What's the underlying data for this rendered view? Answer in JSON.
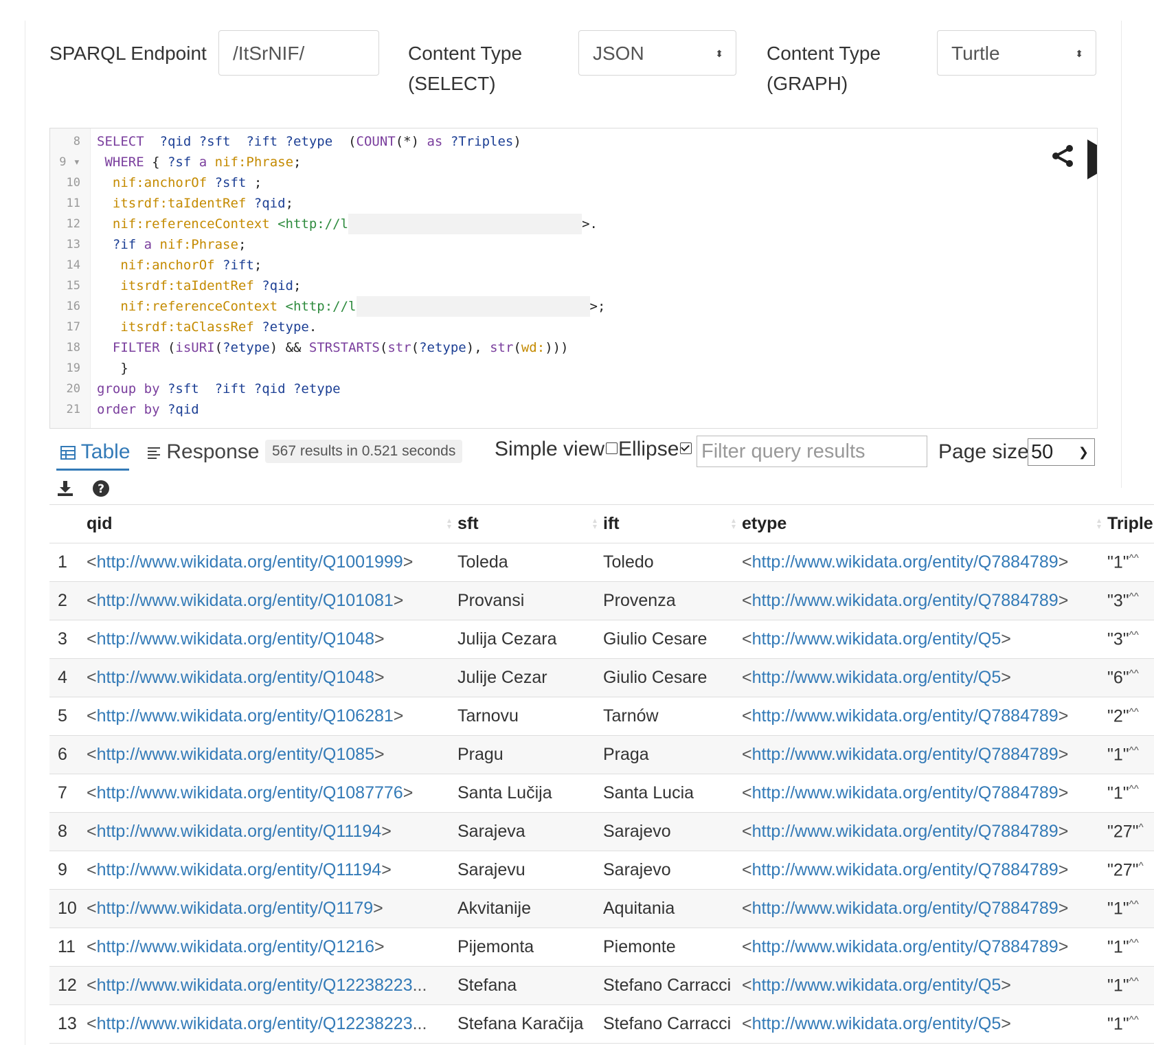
{
  "controls": {
    "endpoint_label": "SPARQL Endpoint",
    "endpoint_value": "/ItSrNIF/",
    "content_select_label_1": "Content Type",
    "content_select_label_2": "(SELECT)",
    "content_select_value": "JSON",
    "content_graph_label_1": "Content Type",
    "content_graph_label_2": "(GRAPH)",
    "content_graph_value": "Turtle"
  },
  "editor": {
    "lines": [
      {
        "n": "8",
        "parts": [
          [
            "kw",
            "SELECT  "
          ],
          [
            "var",
            "?qid ?sft  ?ift ?etype  "
          ],
          [
            "plain",
            "("
          ],
          [
            "kw",
            "COUNT"
          ],
          [
            "plain",
            "(*) "
          ],
          [
            "kw",
            "as "
          ],
          [
            "var",
            "?Triples"
          ],
          [
            "plain",
            ")"
          ]
        ]
      },
      {
        "n": "9 ▾",
        "parts": [
          [
            "plain",
            " "
          ],
          [
            "kw",
            "WHERE "
          ],
          [
            "plain",
            "{ "
          ],
          [
            "var",
            "?sf "
          ],
          [
            "kw",
            "a "
          ],
          [
            "pref",
            "nif:Phrase"
          ],
          [
            "plain",
            ";"
          ]
        ]
      },
      {
        "n": "10",
        "parts": [
          [
            "plain",
            "  "
          ],
          [
            "pref",
            "nif:anchorOf "
          ],
          [
            "var",
            "?sft "
          ],
          [
            "plain",
            ";"
          ]
        ]
      },
      {
        "n": "11",
        "parts": [
          [
            "plain",
            "  "
          ],
          [
            "pref",
            "itsrdf:taIdentRef "
          ],
          [
            "var",
            "?qid"
          ],
          [
            "plain",
            ";"
          ]
        ]
      },
      {
        "n": "12",
        "parts": [
          [
            "plain",
            "  "
          ],
          [
            "pref",
            "nif:referenceContext "
          ],
          [
            "iri",
            "<http://l"
          ],
          [
            "redact",
            ""
          ],
          [
            "plain",
            ">."
          ]
        ]
      },
      {
        "n": "13",
        "parts": [
          [
            "plain",
            "  "
          ],
          [
            "var",
            "?if "
          ],
          [
            "kw",
            "a "
          ],
          [
            "pref",
            "nif:Phrase"
          ],
          [
            "plain",
            ";"
          ]
        ]
      },
      {
        "n": "14",
        "parts": [
          [
            "plain",
            "   "
          ],
          [
            "pref",
            "nif:anchorOf "
          ],
          [
            "var",
            "?ift"
          ],
          [
            "plain",
            ";"
          ]
        ]
      },
      {
        "n": "15",
        "parts": [
          [
            "plain",
            "   "
          ],
          [
            "pref",
            "itsrdf:taIdentRef "
          ],
          [
            "var",
            "?qid"
          ],
          [
            "plain",
            ";"
          ]
        ]
      },
      {
        "n": "16",
        "parts": [
          [
            "plain",
            "   "
          ],
          [
            "pref",
            "nif:referenceContext "
          ],
          [
            "iri",
            "<http://l"
          ],
          [
            "redact",
            ""
          ],
          [
            "plain",
            ">;"
          ]
        ]
      },
      {
        "n": "17",
        "parts": [
          [
            "plain",
            "   "
          ],
          [
            "pref",
            "itsrdf:taClassRef "
          ],
          [
            "var",
            "?etype"
          ],
          [
            "plain",
            "."
          ]
        ]
      },
      {
        "n": "18",
        "parts": [
          [
            "plain",
            "  "
          ],
          [
            "kw",
            "FILTER "
          ],
          [
            "plain",
            "("
          ],
          [
            "kw",
            "isURI"
          ],
          [
            "plain",
            "("
          ],
          [
            "var",
            "?etype"
          ],
          [
            "plain",
            ") && "
          ],
          [
            "kw",
            "STRSTARTS"
          ],
          [
            "plain",
            "("
          ],
          [
            "kw",
            "str"
          ],
          [
            "plain",
            "("
          ],
          [
            "var",
            "?etype"
          ],
          [
            "plain",
            "), "
          ],
          [
            "kw",
            "str"
          ],
          [
            "plain",
            "("
          ],
          [
            "pref",
            "wd:"
          ],
          [
            "plain",
            ")))"
          ]
        ]
      },
      {
        "n": "19",
        "parts": [
          [
            "plain",
            "   }"
          ]
        ]
      },
      {
        "n": "20",
        "parts": [
          [
            "kw",
            "group by "
          ],
          [
            "var",
            "?sft  ?ift ?qid ?etype"
          ]
        ]
      },
      {
        "n": "21",
        "parts": [
          [
            "kw",
            "order by "
          ],
          [
            "var",
            "?qid"
          ]
        ]
      }
    ]
  },
  "results_bar": {
    "tab_table": "Table",
    "tab_response": "Response",
    "results_info": "567 results in 0.521 seconds",
    "simple_view_label": "Simple view",
    "ellipse_label": "Ellipse",
    "filter_placeholder": "Filter query results",
    "page_size_label": "Page size:",
    "page_size_value": "50"
  },
  "table": {
    "columns": [
      "qid",
      "sft",
      "ift",
      "etype",
      "Triple"
    ],
    "rows": [
      {
        "n": "1",
        "qid": "http://www.wikidata.org/entity/Q1001999",
        "qid_end": ">",
        "sft": "Toleda",
        "ift": "Toledo",
        "etype": "http://www.wikidata.org/entity/Q7884789",
        "triples": "\"1\"",
        "sup": "^^"
      },
      {
        "n": "2",
        "qid": "http://www.wikidata.org/entity/Q101081",
        "qid_end": ">",
        "sft": "Provansi",
        "ift": "Provenza",
        "etype": "http://www.wikidata.org/entity/Q7884789",
        "triples": "\"3\"",
        "sup": "^^"
      },
      {
        "n": "3",
        "qid": "http://www.wikidata.org/entity/Q1048",
        "qid_end": ">",
        "sft": "Julija Cezara",
        "ift": "Giulio Cesare",
        "etype": "http://www.wikidata.org/entity/Q5",
        "triples": "\"3\"",
        "sup": "^^"
      },
      {
        "n": "4",
        "qid": "http://www.wikidata.org/entity/Q1048",
        "qid_end": ">",
        "sft": "Julije Cezar",
        "ift": "Giulio Cesare",
        "etype": "http://www.wikidata.org/entity/Q5",
        "triples": "\"6\"",
        "sup": "^^"
      },
      {
        "n": "5",
        "qid": "http://www.wikidata.org/entity/Q106281",
        "qid_end": ">",
        "sft": "Tarnovu",
        "ift": "Tarnów",
        "etype": "http://www.wikidata.org/entity/Q7884789",
        "triples": "\"2\"",
        "sup": "^^"
      },
      {
        "n": "6",
        "qid": "http://www.wikidata.org/entity/Q1085",
        "qid_end": ">",
        "sft": "Pragu",
        "ift": "Praga",
        "etype": "http://www.wikidata.org/entity/Q7884789",
        "triples": "\"1\"",
        "sup": "^^"
      },
      {
        "n": "7",
        "qid": "http://www.wikidata.org/entity/Q1087776",
        "qid_end": ">",
        "sft": "Santa Lučija",
        "ift": "Santa Lucia",
        "etype": "http://www.wikidata.org/entity/Q7884789",
        "triples": "\"1\"",
        "sup": "^^"
      },
      {
        "n": "8",
        "qid": "http://www.wikidata.org/entity/Q11194",
        "qid_end": ">",
        "sft": "Sarajeva",
        "ift": "Sarajevo",
        "etype": "http://www.wikidata.org/entity/Q7884789",
        "triples": "\"27\"",
        "sup": "^"
      },
      {
        "n": "9",
        "qid": "http://www.wikidata.org/entity/Q11194",
        "qid_end": ">",
        "sft": "Sarajevu",
        "ift": "Sarajevo",
        "etype": "http://www.wikidata.org/entity/Q7884789",
        "triples": "\"27\"",
        "sup": "^"
      },
      {
        "n": "10",
        "qid": "http://www.wikidata.org/entity/Q1179",
        "qid_end": ">",
        "sft": "Akvitanije",
        "ift": "Aquitania",
        "etype": "http://www.wikidata.org/entity/Q7884789",
        "triples": "\"1\"",
        "sup": "^^"
      },
      {
        "n": "11",
        "qid": "http://www.wikidata.org/entity/Q1216",
        "qid_end": ">",
        "sft": "Pijemonta",
        "ift": "Piemonte",
        "etype": "http://www.wikidata.org/entity/Q7884789",
        "triples": "\"1\"",
        "sup": "^^"
      },
      {
        "n": "12",
        "qid": "http://www.wikidata.org/entity/Q12238223",
        "qid_end": "...",
        "sft": "Stefana",
        "ift": "Stefano Carracci",
        "etype": "http://www.wikidata.org/entity/Q5",
        "triples": "\"1\"",
        "sup": "^^"
      },
      {
        "n": "13",
        "qid": "http://www.wikidata.org/entity/Q12238223",
        "qid_end": "...",
        "sft": "Stefana Karačija",
        "ift": "Stefano Carracci",
        "etype": "http://www.wikidata.org/entity/Q5",
        "triples": "\"1\"",
        "sup": "^^"
      }
    ]
  },
  "icons": {
    "share": "share-icon",
    "run": "play-icon",
    "table": "table-icon",
    "response": "list-icon",
    "download": "download-icon",
    "help": "help-icon"
  },
  "colors": {
    "link": "#337ab7",
    "keyword": "#7a3e9d",
    "prefix": "#c48a00",
    "variable": "#1c3f94",
    "iri": "#2e8b3e"
  }
}
